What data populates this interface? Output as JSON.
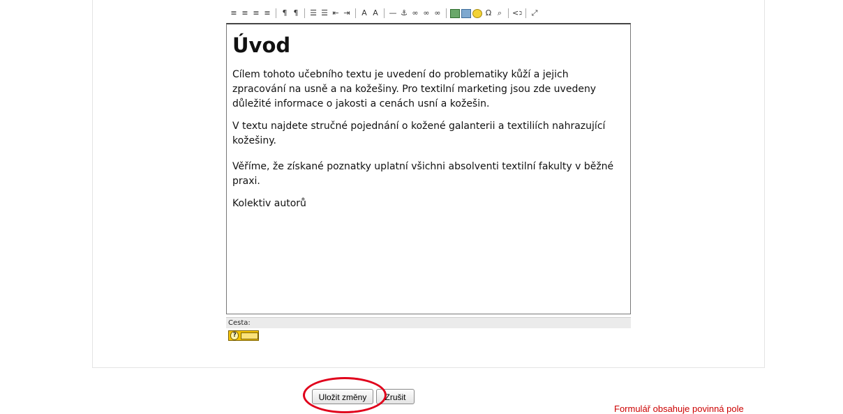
{
  "editor": {
    "heading": "Úvod",
    "paragraphs": [
      "Cílem tohoto učebního textu je uvedení do problematiky kůží a jejich zpracování na usně a na kožešiny. Pro textilní marketing jsou zde uvedeny důležité informace o jakosti a cenách usní a kožešin.",
      "V textu najdete stručné pojednání o kožené galanterii a textiliích nahrazující kožešiny.",
      "Věříme, že získané poznatky uplatní všichni absolventi textilní fakulty v běžné praxi.",
      "Kolektiv autorů"
    ],
    "path_label": "Cesta:"
  },
  "toolbar": {
    "icons": [
      {
        "name": "align-left-icon",
        "glyph": "≡"
      },
      {
        "name": "align-center-icon",
        "glyph": "≡"
      },
      {
        "name": "align-right-icon",
        "glyph": "≡"
      },
      {
        "name": "align-justify-icon",
        "glyph": "≡"
      },
      {
        "name": "sep"
      },
      {
        "name": "ltr-icon",
        "glyph": "¶"
      },
      {
        "name": "rtl-icon",
        "glyph": "¶"
      },
      {
        "name": "sep"
      },
      {
        "name": "ordered-list-icon",
        "glyph": "☰"
      },
      {
        "name": "unordered-list-icon",
        "glyph": "☰"
      },
      {
        "name": "outdent-icon",
        "glyph": "⇤"
      },
      {
        "name": "indent-icon",
        "glyph": "⇥"
      },
      {
        "name": "sep"
      },
      {
        "name": "text-color-icon",
        "glyph": "A"
      },
      {
        "name": "background-color-icon",
        "glyph": "A"
      },
      {
        "name": "sep"
      },
      {
        "name": "horizontal-rule-icon",
        "glyph": "—"
      },
      {
        "name": "anchor-icon",
        "glyph": "⚓"
      },
      {
        "name": "link-icon",
        "glyph": "∞"
      },
      {
        "name": "unlink-icon",
        "glyph": "∞"
      },
      {
        "name": "nolink-icon",
        "glyph": "∞"
      },
      {
        "name": "sep"
      },
      {
        "name": "insert-image-icon",
        "glyph": "",
        "style": "green"
      },
      {
        "name": "insert-table-icon",
        "glyph": "",
        "style": "blue"
      },
      {
        "name": "smiley-icon",
        "glyph": "",
        "style": "yellow"
      },
      {
        "name": "special-char-icon",
        "glyph": "Ω"
      },
      {
        "name": "search-replace-icon",
        "glyph": "⌕"
      },
      {
        "name": "sep"
      },
      {
        "name": "html-source-icon",
        "glyph": "<>"
      },
      {
        "name": "sep"
      },
      {
        "name": "fullscreen-icon",
        "glyph": "⤢"
      }
    ]
  },
  "buttons": {
    "save": "Uložit změny",
    "cancel": "Zrušit"
  },
  "required_note": "Formulář obsahuje povinná pole",
  "colors": {
    "highlight_ring": "#e0001b",
    "required_text": "#cc0000"
  }
}
